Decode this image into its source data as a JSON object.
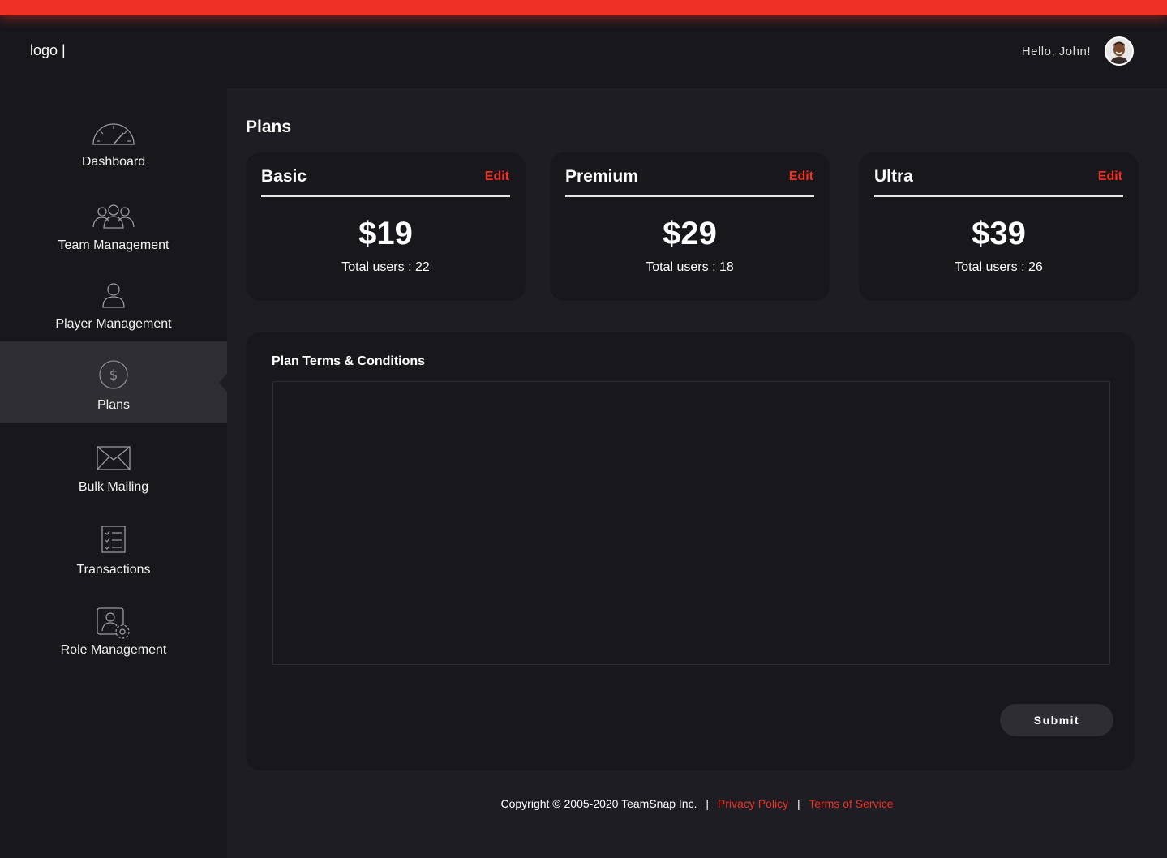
{
  "header": {
    "logo_text": "logo |",
    "greeting": "Hello, John!",
    "avatar_icon": "user-avatar"
  },
  "sidebar": {
    "items": [
      {
        "label": "Dashboard",
        "icon": "speedometer-icon",
        "active": false
      },
      {
        "label": "Team Management",
        "icon": "team-icon",
        "active": false
      },
      {
        "label": "Player Management",
        "icon": "user-icon",
        "active": false
      },
      {
        "label": "Plans",
        "icon": "dollar-icon",
        "active": true
      },
      {
        "label": "Bulk Mailing",
        "icon": "envelope-icon",
        "active": false
      },
      {
        "label": "Transactions",
        "icon": "checklist-icon",
        "active": false
      },
      {
        "label": "Role Management",
        "icon": "user-settings-icon",
        "active": false
      }
    ]
  },
  "main": {
    "title": "Plans",
    "plans": [
      {
        "name": "Basic",
        "edit_label": "Edit",
        "price": "$19",
        "users_text": "Total users : 22"
      },
      {
        "name": "Premium",
        "edit_label": "Edit",
        "price": "$29",
        "users_text": "Total users : 18"
      },
      {
        "name": "Ultra",
        "edit_label": "Edit",
        "price": "$39",
        "users_text": "Total users : 26"
      }
    ],
    "terms": {
      "title": "Plan Terms & Conditions",
      "value": "",
      "submit_label": "Submit"
    }
  },
  "footer": {
    "copyright": "Copyright © 2005-2020 TeamSnap Inc.",
    "separator": "|",
    "privacy_label": "Privacy Policy",
    "terms_label": "Terms of Service"
  },
  "colors": {
    "accent": "#ee3124",
    "sidebar_bg": "#17171c",
    "main_bg": "#1d1d23",
    "active_item_bg": "#2e2e33"
  }
}
